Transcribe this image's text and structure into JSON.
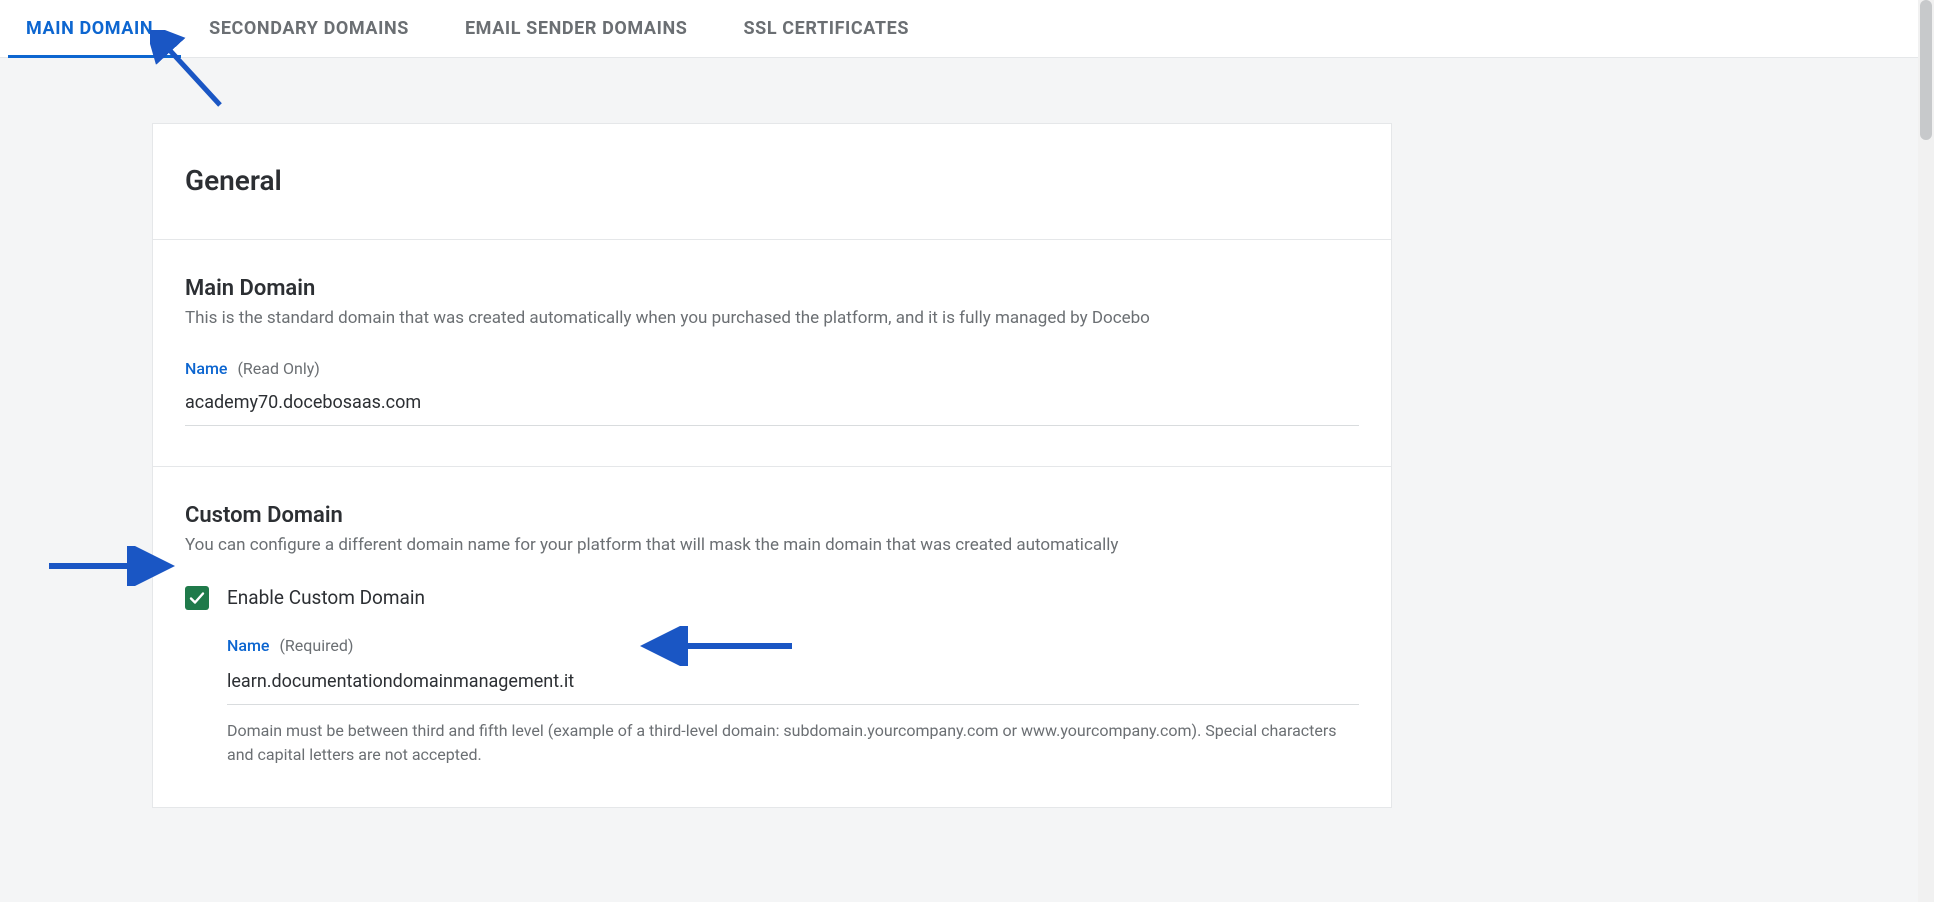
{
  "tabs": [
    {
      "label": "MAIN DOMAIN",
      "active": true
    },
    {
      "label": "SECONDARY DOMAINS",
      "active": false
    },
    {
      "label": "EMAIL SENDER DOMAINS",
      "active": false
    },
    {
      "label": "SSL CERTIFICATES",
      "active": false
    }
  ],
  "card": {
    "title": "General"
  },
  "main_domain": {
    "heading": "Main Domain",
    "description": "This is the standard domain that was created automatically when you purchased the platform, and it is fully managed by Docebo",
    "name_label": "Name",
    "name_hint": "(Read Only)",
    "value": "academy70.docebosaas.com"
  },
  "custom_domain": {
    "heading": "Custom Domain",
    "description": "You can configure a different domain name for your platform that will mask the main domain that was created automatically",
    "checkbox_label": "Enable Custom Domain",
    "checkbox_checked": true,
    "name_label": "Name",
    "name_hint": "(Required)",
    "value": "learn.documentationdomainmanagement.it",
    "helper": "Domain must be between third and fifth level (example of a third-level domain: subdomain.yourcompany.com or www.yourcompany.com). Special characters and capital letters are not accepted."
  },
  "colors": {
    "accent": "#0d66d0",
    "checkbox": "#1f7a4a",
    "text": "#2c2f33",
    "muted": "#6b6f73"
  }
}
